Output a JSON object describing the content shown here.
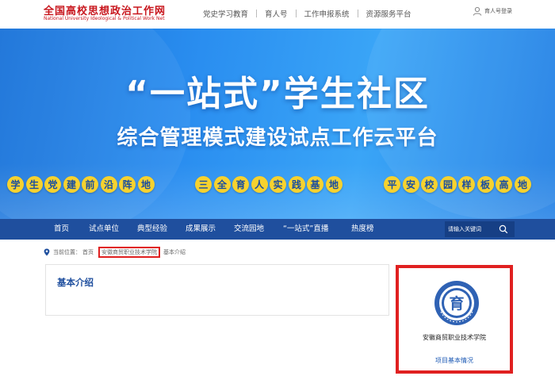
{
  "site": {
    "logo_cn": "全国高校思想政治工作网",
    "logo_en": "National University Ideological & Political Work Net"
  },
  "topnav": [
    "党史学习教育",
    "育人号",
    "工作申报系统",
    "资源服务平台"
  ],
  "login": {
    "label": "育人号登录",
    "icon": "user-icon"
  },
  "banner": {
    "title": "“一站式”学生社区",
    "subtitle": "综合管理模式建设试点工作云平台",
    "slogans": [
      "学生党建前沿阵地",
      "三全育人实践基地",
      "平安校园样板高地"
    ]
  },
  "mainnav": [
    "首页",
    "试点单位",
    "典型经验",
    "成果展示",
    "交流园地",
    "“一站式”直播",
    "热度榜"
  ],
  "search": {
    "placeholder": "请输入关键词",
    "icon": "search-icon"
  },
  "breadcrumb": {
    "label": "当前位置：",
    "home": "首页",
    "school": "安徽商贸职业技术学院",
    "current": "基本介绍"
  },
  "content": {
    "title": "基本介绍"
  },
  "card": {
    "name": "安徽商贸职业技术学院",
    "link": "项目基本情况",
    "emblem_text": "育",
    "emblem_ring": "高校思想政治工作网 · 育人号"
  },
  "colors": {
    "brand_red": "#c8161d",
    "nav_blue": "#1f4f9e",
    "banner_blue": "#2a8ef0",
    "slogan_yellow": "#f6d22f",
    "highlight_red": "#e02020"
  }
}
